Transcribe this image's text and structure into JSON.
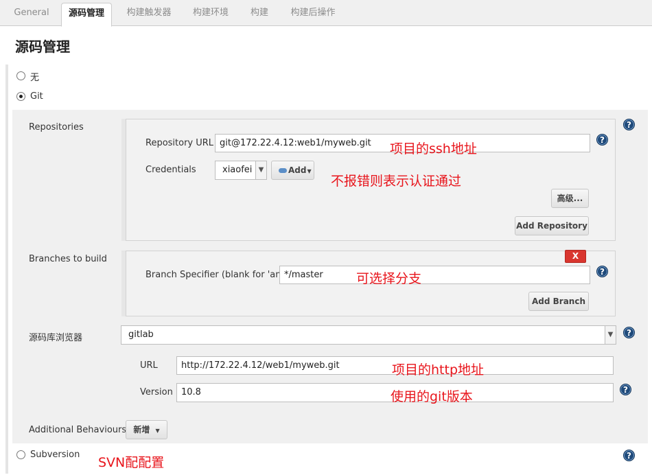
{
  "tabs": [
    "General",
    "源码管理",
    "构建触发器",
    "构建环境",
    "构建",
    "构建后操作"
  ],
  "active_tab": "源码管理",
  "section_title": "源码管理",
  "scm": {
    "none_label": "无",
    "git_label": "Git",
    "subversion_label": "Subversion",
    "selected": "Git"
  },
  "repositories": {
    "label": "Repositories",
    "url_label": "Repository URL",
    "url_value": "git@172.22.4.12:web1/myweb.git",
    "credentials_label": "Credentials",
    "credentials_value": "xiaofei",
    "add_label": "Add",
    "advanced_label": "高级...",
    "add_repository_label": "Add Repository"
  },
  "branches": {
    "label": "Branches to build",
    "delete_label": "X",
    "specifier_label": "Branch Specifier (blank for 'any')",
    "specifier_value": "*/master",
    "add_branch_label": "Add Branch"
  },
  "browser": {
    "label": "源码库浏览器",
    "value": "gitlab",
    "url_label": "URL",
    "url_value": "http://172.22.4.12/web1/myweb.git",
    "version_label": "Version",
    "version_value": "10.8"
  },
  "additional": {
    "label": "Additional Behaviours",
    "button_label": "新增"
  },
  "annotations": {
    "ssh": "项目的ssh地址",
    "auth": "不报错则表示认证通过",
    "branch": "可选择分支",
    "http": "项目的http地址",
    "version": "使用的git版本",
    "svn": "SVN配配置"
  },
  "help_symbol": "?",
  "colors": {
    "annotation": "#e8141b",
    "help_icon": "#1f4a7a",
    "delete_button": "#d9362f"
  }
}
